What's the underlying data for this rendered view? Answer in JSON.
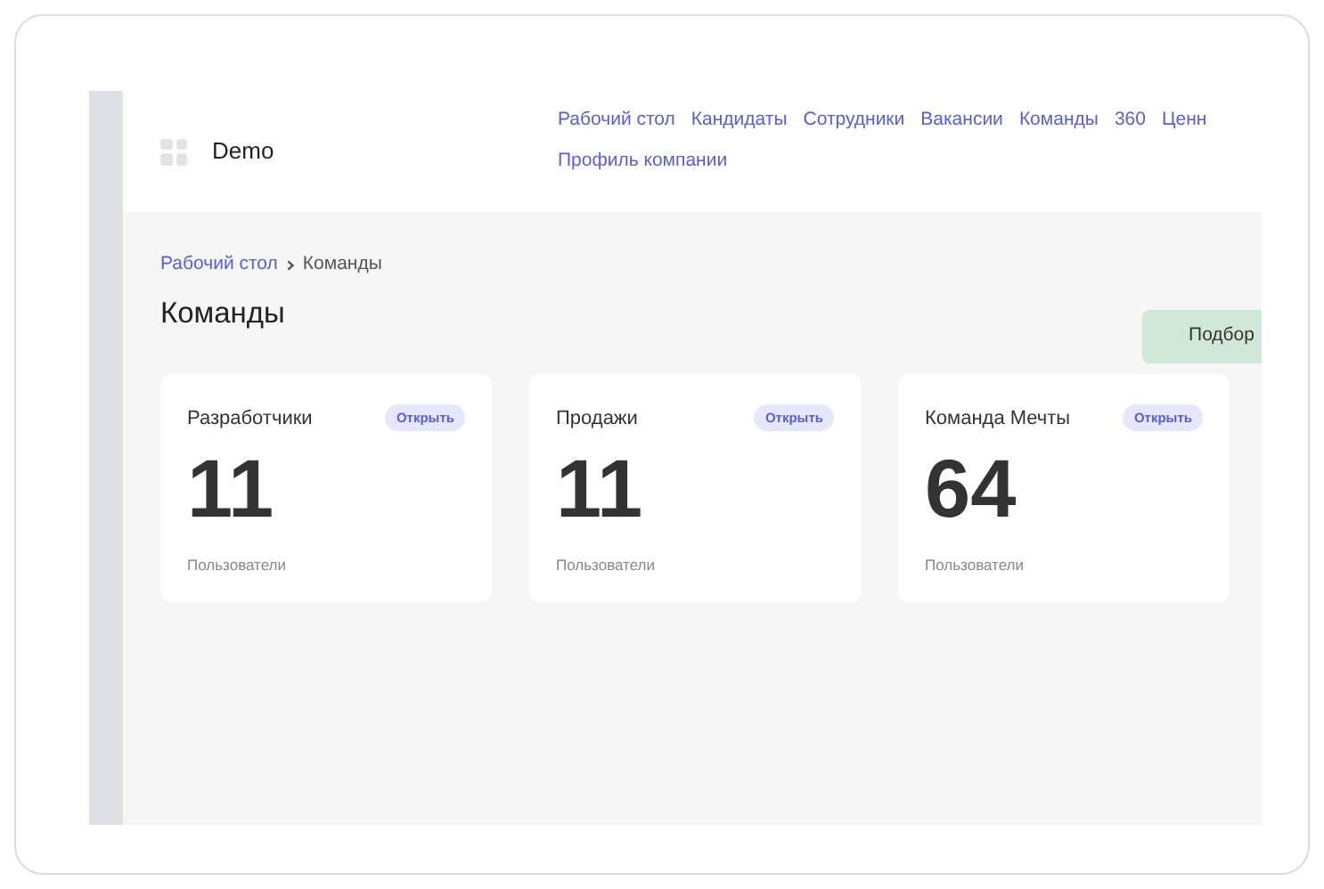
{
  "logo": {
    "text": "Demo"
  },
  "nav_rows": [
    [
      {
        "label": "Рабочий стол"
      },
      {
        "label": "Кандидаты"
      },
      {
        "label": "Сотрудники"
      },
      {
        "label": "Вакансии"
      },
      {
        "label": "Команды"
      },
      {
        "label": "360"
      },
      {
        "label": "Ценн"
      }
    ],
    [
      {
        "label": "Профиль компании"
      }
    ]
  ],
  "breadcrumb": [
    {
      "label": "Рабочий стол",
      "kind": "link"
    },
    {
      "label": "Команды",
      "kind": "current"
    }
  ],
  "title": "Команды",
  "action_button": "Подбор",
  "teams": [
    {
      "name": "Разработчики",
      "badge": "Открыть",
      "count": "11",
      "caption": "Пользователи"
    },
    {
      "name": "Продажи",
      "badge": "Открыть",
      "count": "11",
      "caption": "Пользователи"
    },
    {
      "name": "Команда Мечты",
      "badge": "Открыть",
      "count": "64",
      "caption": "Пользователи"
    }
  ]
}
